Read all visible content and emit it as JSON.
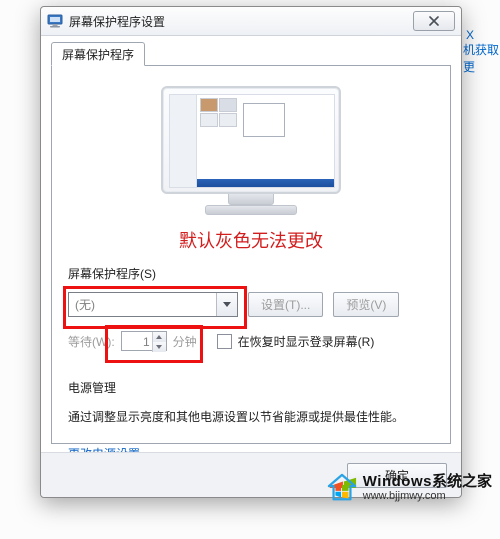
{
  "bg": {
    "a": "X",
    "b": "机获取更"
  },
  "dialog": {
    "title": "屏幕保护程序设置",
    "close_tooltip": "关闭"
  },
  "tab": {
    "label": "屏幕保护程序"
  },
  "annotation": "默认灰色无法更改",
  "screensaver": {
    "section_label": "屏幕保护程序(S)",
    "selected": "(无)",
    "settings_btn": "设置(T)...",
    "preview_btn": "预览(V)",
    "wait_label": "等待(W):",
    "wait_value": "1",
    "wait_unit": "分钟",
    "resume_checkbox": "在恢复时显示登录屏幕(R)"
  },
  "power": {
    "title": "电源管理",
    "desc": "通过调整显示亮度和其他电源设置以节省能源或提供最佳性能。",
    "link": "更改电源设置"
  },
  "buttons": {
    "ok": "确定"
  },
  "watermark": {
    "line1_prefix": "Windows",
    "line1_suffix": "系统之家",
    "line2": "www.bjjmwy.com"
  }
}
